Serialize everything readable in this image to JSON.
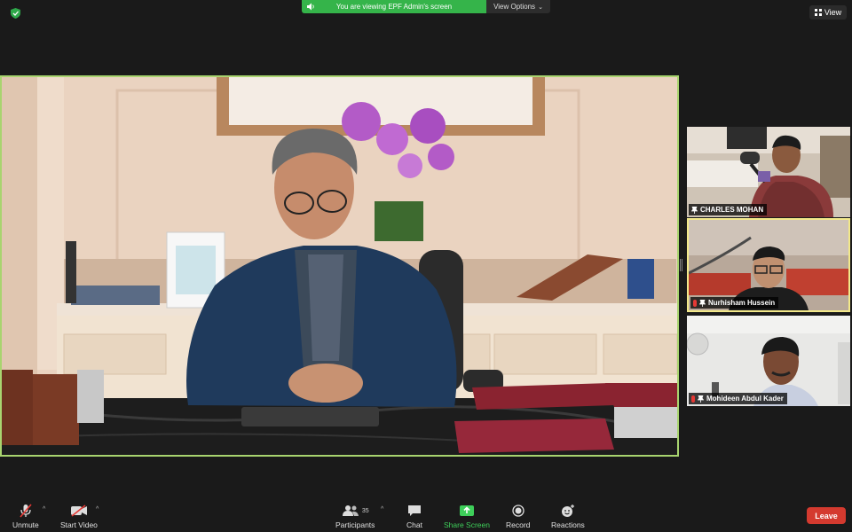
{
  "top_bar": {
    "share_banner": "You are viewing EPF Admin's screen",
    "view_options_label": "View Options",
    "view_label": "View"
  },
  "participants": [
    {
      "name": "CHARLES MOHAN",
      "muted": true
    },
    {
      "name": "Nurhisham Hussein",
      "muted": true
    },
    {
      "name": "Mohideen Abdul Kader",
      "muted": true
    }
  ],
  "toolbar": {
    "unmute_label": "Unmute",
    "start_video_label": "Start Video",
    "participants_label": "Participants",
    "participants_count": "35",
    "chat_label": "Chat",
    "share_screen_label": "Share Screen",
    "record_label": "Record",
    "reactions_label": "Reactions",
    "leave_label": "Leave"
  },
  "colors": {
    "share_banner": "#35b44a",
    "active_speaker_border": "#a8d46f",
    "leave": "#d43a2f",
    "share_icon": "#3ecf5a"
  }
}
